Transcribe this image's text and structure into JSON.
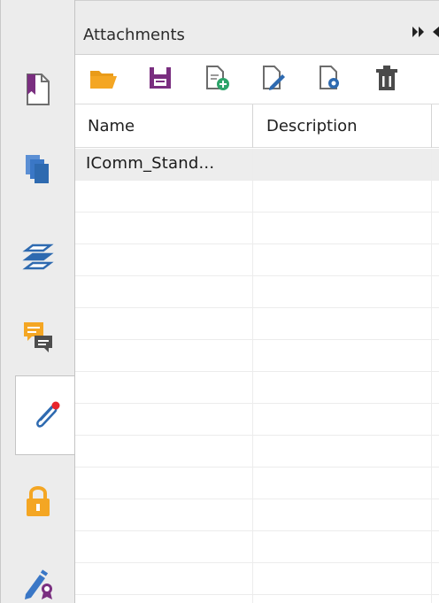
{
  "panel": {
    "title": "Attachments"
  },
  "header_controls": {
    "collapse_icon": "double-arrow-right-icon",
    "prev_icon": "arrow-left-icon"
  },
  "rail": {
    "items": [
      {
        "name": "pages",
        "icon": "page-bookmark-icon"
      },
      {
        "name": "thumbnails",
        "icon": "copy-pages-icon"
      },
      {
        "name": "layers",
        "icon": "layers-icon"
      },
      {
        "name": "comments",
        "icon": "comments-icon"
      },
      {
        "name": "attachments",
        "icon": "paperclip-icon",
        "active": true
      },
      {
        "name": "security",
        "icon": "lock-icon"
      },
      {
        "name": "signatures",
        "icon": "pen-certificate-icon"
      }
    ]
  },
  "toolbar": {
    "buttons": [
      {
        "name": "open",
        "icon": "folder-open-icon"
      },
      {
        "name": "save",
        "icon": "floppy-disk-icon"
      },
      {
        "name": "add",
        "icon": "add-file-icon"
      },
      {
        "name": "edit",
        "icon": "edit-file-icon"
      },
      {
        "name": "properties",
        "icon": "file-settings-icon"
      },
      {
        "name": "delete",
        "icon": "trash-icon"
      }
    ]
  },
  "table": {
    "columns": [
      "Name",
      "Description"
    ],
    "rows": [
      {
        "name": "IComm_Stand...",
        "description": ""
      }
    ]
  },
  "colors": {
    "purple": "#7a2f80",
    "orange": "#f4a623",
    "blue": "#2e6ab0",
    "gray": "#5a5a5a"
  }
}
